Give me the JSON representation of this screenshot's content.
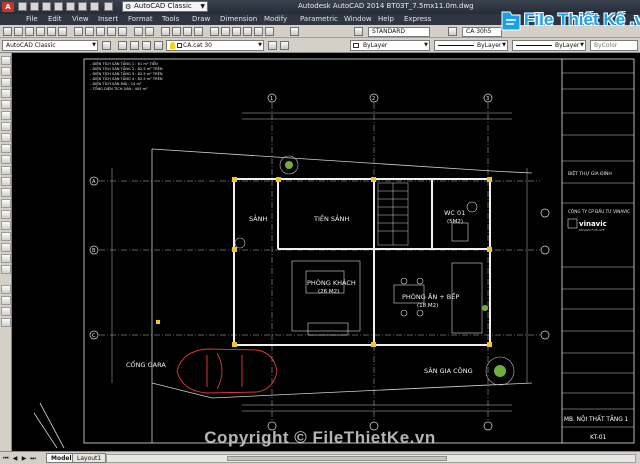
{
  "window": {
    "app_logo": "A",
    "workspace": "AutoCAD Classic",
    "title": "Autodesk AutoCAD 2014    BT03T_7.5mx11.0m.dwg"
  },
  "menu": {
    "items": [
      "File",
      "Edit",
      "View",
      "Insert",
      "Format",
      "Tools",
      "Draw",
      "Dimension",
      "Modify",
      "Parametric",
      "Window",
      "Help",
      "Express"
    ]
  },
  "toolbar": {
    "text_style": "STANDARD",
    "dim_style": "CA 30h5"
  },
  "properties": {
    "workspace_select": "AutoCAD Classic",
    "layer": "CA.cat 30",
    "color": "ByLayer",
    "linetype": "ByLayer",
    "lineweight": "ByLayer",
    "plotstyle": "ByColor"
  },
  "watermark": {
    "logo_text": "File Thiết Kế .vn",
    "copyright": "Copyright © FileThietKe.vn"
  },
  "drawing": {
    "area_notes": [
      "- DIỆN TÍCH SÀN TẦNG 1 : 61 m² TIỀN",
      "- DIỆN TÍCH SÀN TẦNG 2 : 82.5 m² TRÊN",
      "- DIỆN TÍCH SÀN TẦNG 3 : 82.5 m² TRÊN",
      "- DIỆN TÍCH SÀN TẦNG 4 : 82.5 m² TRÊN",
      "- DIỆN TÍCH SÀN MÁI : 14 m²",
      "- TỔNG DIỆN TÍCH SÀN    : 405 m²"
    ],
    "grid_cols": [
      "1",
      "2",
      "3"
    ],
    "grid_rows": [
      "A",
      "B",
      "C"
    ],
    "rooms": {
      "tien_sanh": "TIỀN SẢNH",
      "sanh": "SẢNH",
      "wc": "WC 01",
      "wc_area": "(5M2)",
      "phong_khach": "PHÒNG KHÁCH",
      "phong_khach_area": "(26 M2)",
      "phong_an": "PHÒNG ĂN + BẾP",
      "phong_an_area": "(18 M2)",
      "cong_gara": "CỔNG GARA",
      "san_gia_cong": "SÂN GIA CÔNG"
    },
    "title_block": {
      "project": "BIỆT THỰ GIA ĐÌNH",
      "company": "CÔNG TY CP ĐẦU TƯ VINAVIC",
      "brand": "vinavic",
      "brand_sub": "DESIGN FOR LIFE",
      "sheet_title": "MB. NỘI THẤT TẦNG 1",
      "sheet_no": "KT-01"
    }
  },
  "tabs": {
    "model": "Model",
    "layout": "Layout1"
  }
}
